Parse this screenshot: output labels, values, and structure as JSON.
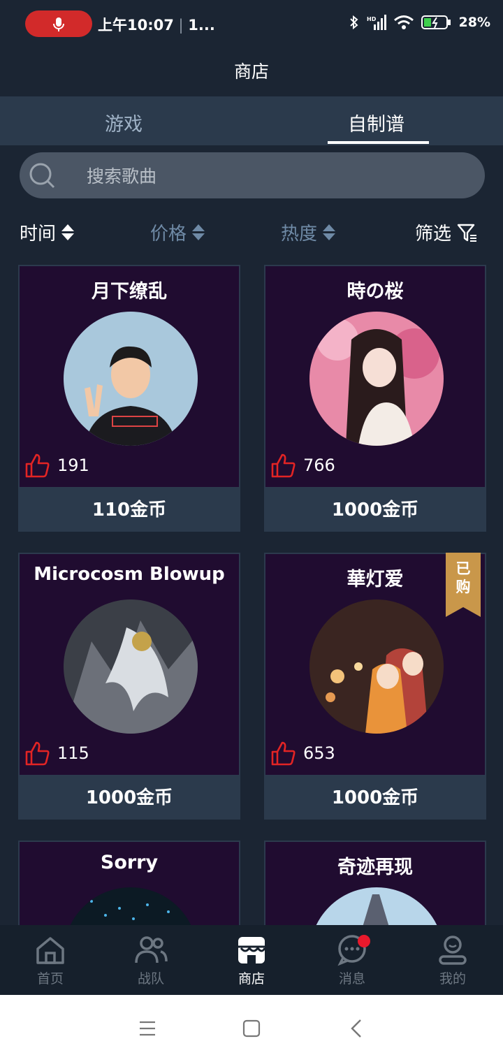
{
  "status_bar": {
    "time": "上午10:07",
    "extra": "1...",
    "battery": "28%"
  },
  "header": {
    "title": "商店"
  },
  "tabs": [
    {
      "label": "游戏"
    },
    {
      "label": "自制谱"
    }
  ],
  "search": {
    "placeholder": "搜索歌曲"
  },
  "sort": {
    "time": "时间",
    "price": "价格",
    "heat": "热度",
    "filter": "筛选"
  },
  "cards": [
    {
      "title": "月下缭乱",
      "likes": "191",
      "price": "110金币"
    },
    {
      "title": "時の桜",
      "likes": "766",
      "price": "1000金币"
    },
    {
      "title": "Microcosm Blowup",
      "likes": "115",
      "price": "1000金币"
    },
    {
      "title": "華灯爱",
      "likes": "653",
      "price": "1000金币",
      "badge": "已购"
    },
    {
      "title": "Sorry"
    },
    {
      "title": "奇迹再现"
    }
  ],
  "nav": [
    {
      "label": "首页"
    },
    {
      "label": "战队"
    },
    {
      "label": "商店"
    },
    {
      "label": "消息"
    },
    {
      "label": "我的"
    }
  ],
  "colors": {
    "accent_red": "#d22a2a",
    "badge_gold": "#c9974a",
    "card_bg": "#200c30",
    "page_bg": "#1b2533"
  }
}
